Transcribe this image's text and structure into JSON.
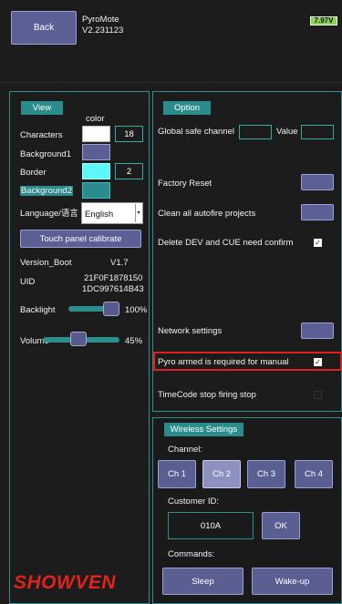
{
  "header": {
    "back_label": "Back",
    "app_name": "PyroMote",
    "version": "V2.231123",
    "battery": "7.97V"
  },
  "view": {
    "title": "View",
    "color_header": "color",
    "characters_label": "Characters",
    "characters_value": "18",
    "background1_label": "Background1",
    "border_label": "Border",
    "border_value": "2",
    "background2_label": "Background2",
    "language_label": "Language/语言",
    "language_value": "English",
    "calibrate_label": "Touch panel calibrate",
    "version_boot_label": "Version_Boot",
    "version_boot_value": "V1.7",
    "uid_label": "UID",
    "uid_line1": "21F0F1878150",
    "uid_line2": "1DC997614B43",
    "backlight_label": "Backlight",
    "backlight_value": "100%",
    "backlight_level": 1.0,
    "volume_label": "Volume",
    "volume_value": "45%",
    "volume_level": 0.45
  },
  "option": {
    "title": "Option",
    "global_safe_label": "Global safe channel",
    "global_safe_value": "",
    "value_label": "Value",
    "value_value": "",
    "factory_reset_label": "Factory Reset",
    "clean_autofire_label": "Clean all autofire projects",
    "delete_confirm_label": "Delete DEV and CUE need confirm",
    "delete_confirm_checked": true,
    "network_label": "Network settings",
    "pyro_armed_label": "Pyro armed is required for manual",
    "pyro_armed_checked": true,
    "timecode_label": "TimeCode stop firing stop",
    "timecode_checked": false
  },
  "wireless": {
    "title": "Wireless Settings",
    "channel_label": "Channel:",
    "channels": [
      "Ch 1",
      "Ch 2",
      "Ch 3",
      "Ch 4"
    ],
    "selected_channel": "Ch 2",
    "customer_id_label": "Customer ID:",
    "customer_id_value": "010A",
    "ok_label": "OK",
    "commands_label": "Commands:",
    "sleep_label": "Sleep",
    "wakeup_label": "Wake-up"
  },
  "brand": {
    "logo_text": "SHOWVEN",
    "colors": {
      "logo": "#e0241b",
      "highlight": "#e02020",
      "accent": "#2a8c8c",
      "button": "#5b5f93"
    }
  }
}
